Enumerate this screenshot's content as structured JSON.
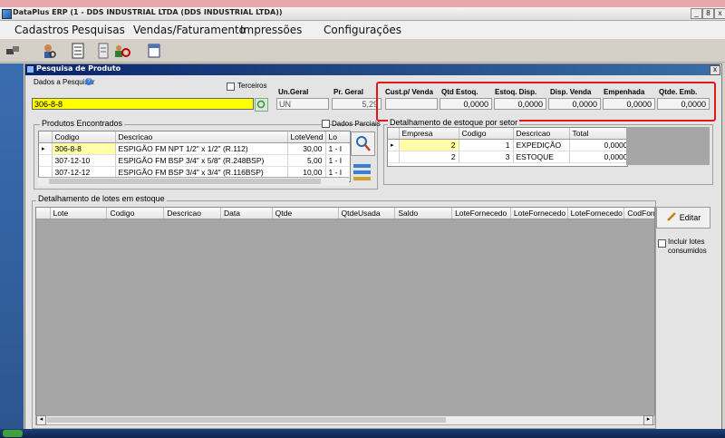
{
  "app": {
    "title": "DataPlus ERP (1 - DDS INDUSTRIAL LTDA  (DDS INDUSTRIAL LTDA))",
    "window_buttons": [
      "_",
      "8",
      "x"
    ]
  },
  "menu": [
    "Cadastros",
    "Pesquisas",
    "Vendas/Faturamento",
    "Impressões",
    "Configurações"
  ],
  "toolbar": [
    "link-icon",
    "person-search-icon",
    "document-list-icon",
    "notepad-icon",
    "people-search-icon",
    "calendar-icon"
  ],
  "dialog": {
    "title": "Pesquisa de Produto",
    "close": "x",
    "search_label": "Dados a Pesquisar",
    "search_value": "306-8-8",
    "terceiros_label": "Terceiros",
    "un_geral_label": "Un.Geral",
    "un_geral_value": "UN",
    "pr_geral_label": "Pr. Geral",
    "pr_geral_value": "5,29",
    "stock_headers": [
      "Cust.p/ Venda",
      "Qtd Estoq.",
      "Estoq. Disp.",
      "Disp. Venda",
      "Empenhada",
      "Qtde. Emb."
    ],
    "stock_values": [
      "",
      "0,0000",
      "0,0000",
      "0,0000",
      "0,0000",
      "0,0000"
    ]
  },
  "produtos": {
    "title": "Produtos Encontrados",
    "parciais_label": "Dados Parciais",
    "columns": [
      "Codigo",
      "Descricao",
      "LoteVend",
      "Lo"
    ],
    "rows": [
      {
        "codigo": "306-8-8",
        "descricao": "ESPIGÃO FM NPT 1/2\" x 1/2\" (R.112)",
        "lote": "30,00",
        "lo": "1 - I"
      },
      {
        "codigo": "307-12-10",
        "descricao": "ESPIGÃO FM BSP 3/4\" x 5/8\" (R.248BSP)",
        "lote": "5,00",
        "lo": "1 - I"
      },
      {
        "codigo": "307-12-12",
        "descricao": "ESPIGÃO FM BSP 3/4\" x 3/4\" (R.116BSP)",
        "lote": "10,00",
        "lo": "1 - I"
      }
    ]
  },
  "estoque_setor": {
    "title": "Detalhamento de estoque por setor",
    "columns": [
      "Empresa",
      "Codigo",
      "Descricao",
      "Total"
    ],
    "rows": [
      {
        "empresa": "2",
        "codigo": "1",
        "descricao": "EXPEDIÇÃO",
        "total": "0,0000"
      },
      {
        "empresa": "2",
        "codigo": "3",
        "descricao": "ESTOQUE",
        "total": "0,0000"
      }
    ]
  },
  "lotes": {
    "title": "Detalhamento de lotes em estoque",
    "columns": [
      "Lote",
      "Codigo",
      "Descricao",
      "Data",
      "Qtde",
      "QtdeUsada",
      "Saldo",
      "LoteFornecedo",
      "LoteFornecedo",
      "LoteFornecedo",
      "CodForne"
    ],
    "editar_label": "Editar",
    "incluir_label": "Incluir lotes consumidos"
  },
  "colors": {
    "highlight_yellow": "#ffff00",
    "red_outline": "#e01818",
    "titlebar_blue": "#0a246a"
  }
}
